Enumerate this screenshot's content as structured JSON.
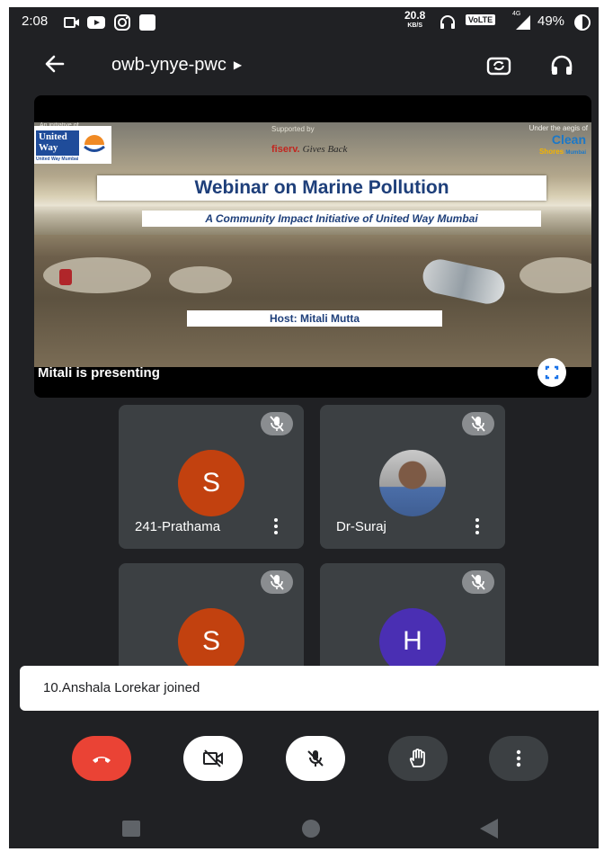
{
  "status_bar": {
    "time": "2:08",
    "speed": "20.8",
    "speed_unit": "KB/S",
    "network_badge": "VoLTE",
    "network": "4G",
    "battery": "49%"
  },
  "header": {
    "meeting_code": "owb-ynye-pwc"
  },
  "presentation": {
    "presenter_text": "Mitali is presenting",
    "slide": {
      "initiative_label": "An initiative of",
      "left_logo_line1": "United",
      "left_logo_line2": "Way",
      "left_logo_tagline": "United Way Mumbai",
      "supported_label": "Supported by",
      "sponsor_brand": "fiserv.",
      "sponsor_text": "Gives Back",
      "aegis_label": "Under the aegis of",
      "right_logo_main": "Clean",
      "right_logo_sub": "Shores",
      "right_logo_city": "Mumbai",
      "title": "Webinar on Marine Pollution",
      "subtitle": "A Community Impact Initiative of  United Way Mumbai",
      "host": "Host: Mitali Mutta"
    }
  },
  "participants": [
    {
      "name": "241-Prathama",
      "initial": "S"
    },
    {
      "name": "Dr-Suraj"
    },
    {
      "initial": "S"
    },
    {
      "initial": "H"
    }
  ],
  "toast": {
    "message": "10.Anshala Lorekar joined"
  },
  "colors": {
    "background": "#202124",
    "tile": "#3c4043",
    "end_call": "#ea4335",
    "avatar_s": "#c2410f",
    "avatar_h": "#4a2fb3",
    "slide_text": "#1e3f7a"
  },
  "icons": [
    "camera-status-icon",
    "youtube-status-icon",
    "instagram-status-icon",
    "app-status-icon",
    "headset-status-icon",
    "signal-icon",
    "battery-icon",
    "back-arrow-icon",
    "switch-camera-icon",
    "audio-output-icon",
    "fullscreen-icon",
    "mic-off-icon",
    "more-vert-icon",
    "call-end-icon",
    "camera-off-icon",
    "raise-hand-icon"
  ]
}
